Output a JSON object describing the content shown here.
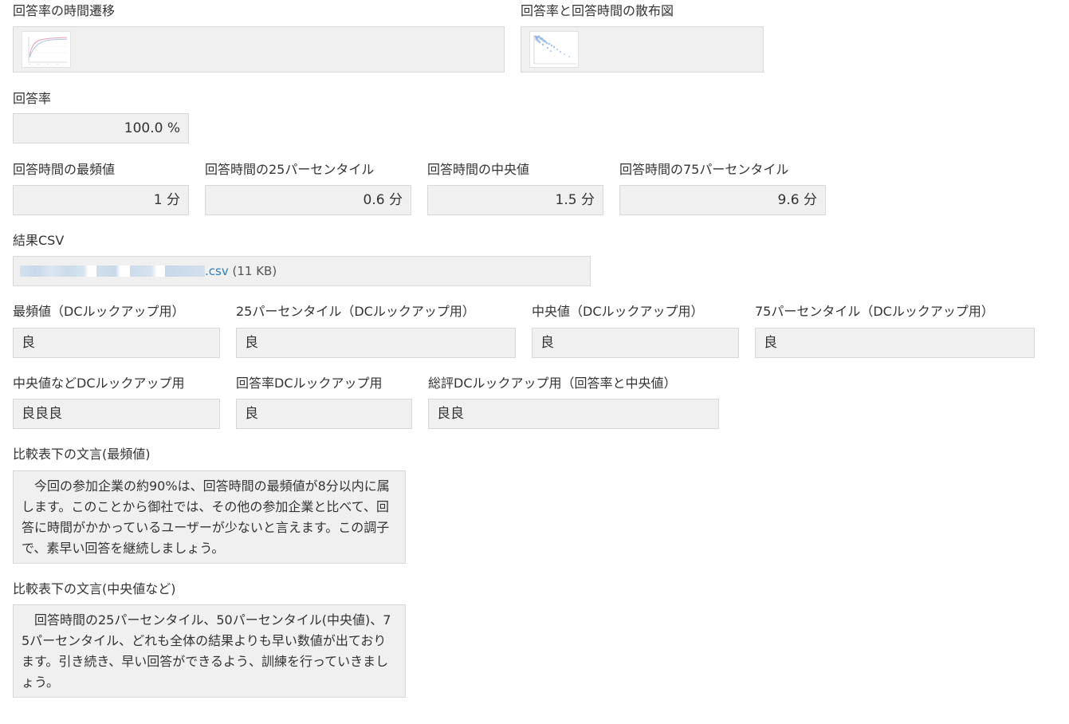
{
  "charts": {
    "time_series": {
      "label": "回答率の時間遷移"
    },
    "scatter": {
      "label": "回答率と回答時間の散布図"
    }
  },
  "response_rate": {
    "label": "回答率",
    "value": "100.0 %"
  },
  "response_time": {
    "mode": {
      "label": "回答時間の最頻値",
      "value": "1 分"
    },
    "p25": {
      "label": "回答時間の25パーセンタイル",
      "value": "0.6 分"
    },
    "median": {
      "label": "回答時間の中央値",
      "value": "1.5 分"
    },
    "p75": {
      "label": "回答時間の75パーセンタイル",
      "value": "9.6 分"
    }
  },
  "result_csv": {
    "label": "結果CSV",
    "extension": ".csv",
    "size": "(11 KB)"
  },
  "lookups": {
    "mode": {
      "label": "最頻値（DCルックアップ用）",
      "value": "良"
    },
    "p25": {
      "label": "25パーセンタイル（DCルックアップ用）",
      "value": "良"
    },
    "median": {
      "label": "中央値（DCルックアップ用）",
      "value": "良"
    },
    "p75": {
      "label": "75パーセンタイル（DCルックアップ用）",
      "value": "良"
    },
    "median_etc": {
      "label": "中央値などDCルックアップ用",
      "value": "良良良"
    },
    "rate": {
      "label": "回答率DCルックアップ用",
      "value": "良"
    },
    "overall": {
      "label": "総評DCルックアップ用（回答率と中央値）",
      "value": "良良"
    }
  },
  "comments": {
    "mode": {
      "label": "比較表下の文言(最頻値)",
      "text": "今回の参加企業の約90%は、回答時間の最頻値が8分以内に属します。このことから御社では、その他の参加企業と比べて、回答に時間がかかっているユーザーが少ないと言えます。この調子で、素早い回答を継続しましょう。"
    },
    "median": {
      "label": "比較表下の文言(中央値など)",
      "text": "回答時間の25パーセンタイル、50パーセンタイル(中央値)、75パーセンタイル、どれも全体の結果よりも早い数値が出ております。引き続き、早い回答ができるよう、訓練を行っていきましょう。"
    }
  },
  "colors": {
    "box_bg": "#f0f0f0",
    "box_border": "#d8d8d8",
    "link": "#2a7fc4"
  }
}
